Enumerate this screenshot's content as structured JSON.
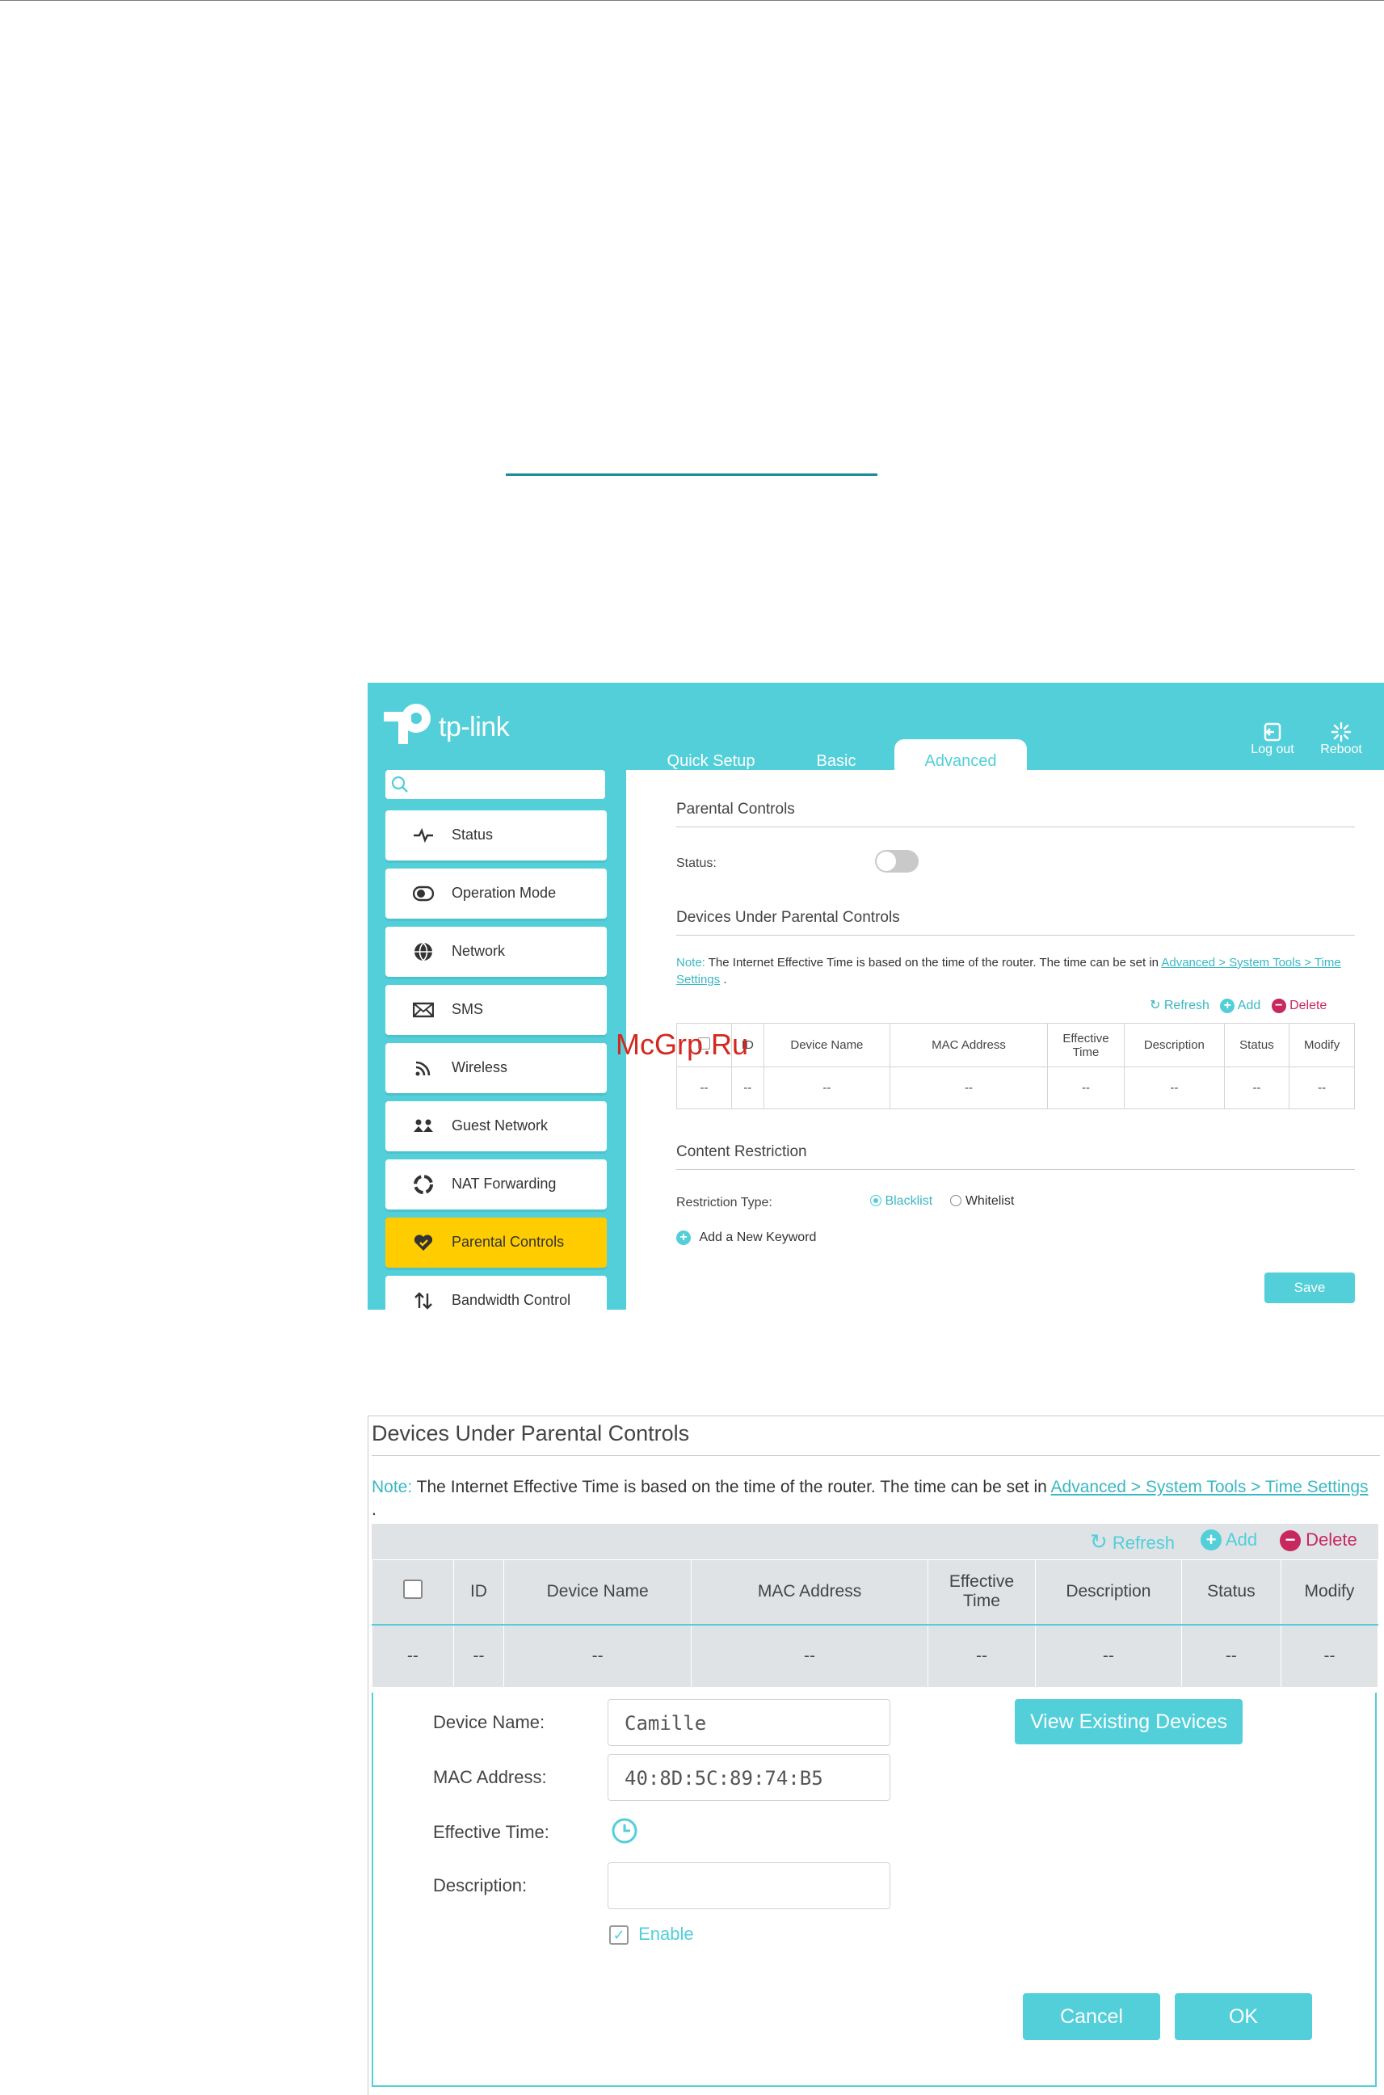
{
  "brand": {
    "logo_text": "tp-link",
    "accent": "#52cfd9",
    "active_menu": "#ffcc00",
    "delete_color": "#c8285e"
  },
  "header": {
    "tabs": [
      {
        "label": "Quick Setup"
      },
      {
        "label": "Basic"
      },
      {
        "label": "Advanced"
      }
    ],
    "logout": "Log out",
    "reboot": "Reboot"
  },
  "sidebar": {
    "items": [
      {
        "label": "Status",
        "icon": "pulse-icon"
      },
      {
        "label": "Operation Mode",
        "icon": "toggle-mode-icon"
      },
      {
        "label": "Network",
        "icon": "globe-icon"
      },
      {
        "label": "SMS",
        "icon": "envelope-icon"
      },
      {
        "label": "Wireless",
        "icon": "wifi-icon"
      },
      {
        "label": "Guest Network",
        "icon": "guests-icon"
      },
      {
        "label": "NAT Forwarding",
        "icon": "nat-icon"
      },
      {
        "label": "Parental Controls",
        "icon": "heart-shield-icon",
        "active": true
      },
      {
        "label": "Bandwidth Control",
        "icon": "arrows-updown-icon"
      }
    ]
  },
  "parental": {
    "title": "Parental Controls",
    "status_label": "Status:",
    "devices_title": "Devices Under Parental Controls",
    "note_label": "Note:",
    "note_text": "The Internet Effective Time is based on the time of the router. The time can be set in",
    "note_link": "Advanced > System Tools > Time Settings",
    "note_end": ".",
    "actions": {
      "refresh": "Refresh",
      "add": "Add",
      "delete": "Delete"
    },
    "columns": [
      "ID",
      "Device Name",
      "MAC Address",
      "Effective Time",
      "Description",
      "Status",
      "Modify"
    ],
    "empty_cell": "--",
    "content_title": "Content Restriction",
    "restriction_label": "Restriction Type:",
    "blacklist": "Blacklist",
    "whitelist": "Whitelist",
    "add_keyword": "Add a New Keyword",
    "save": "Save"
  },
  "dialog": {
    "title": "Devices Under Parental Controls",
    "device_name_label": "Device Name:",
    "device_name_value": "Camille",
    "view_devices": "View Existing Devices",
    "mac_label": "MAC Address:",
    "mac_value": "40:8D:5C:89:74:B5",
    "effective_label": "Effective Time:",
    "description_label": "Description:",
    "description_value": "",
    "enable_label": "Enable",
    "cancel": "Cancel",
    "ok": "OK"
  },
  "watermark": "McGrp.Ru"
}
